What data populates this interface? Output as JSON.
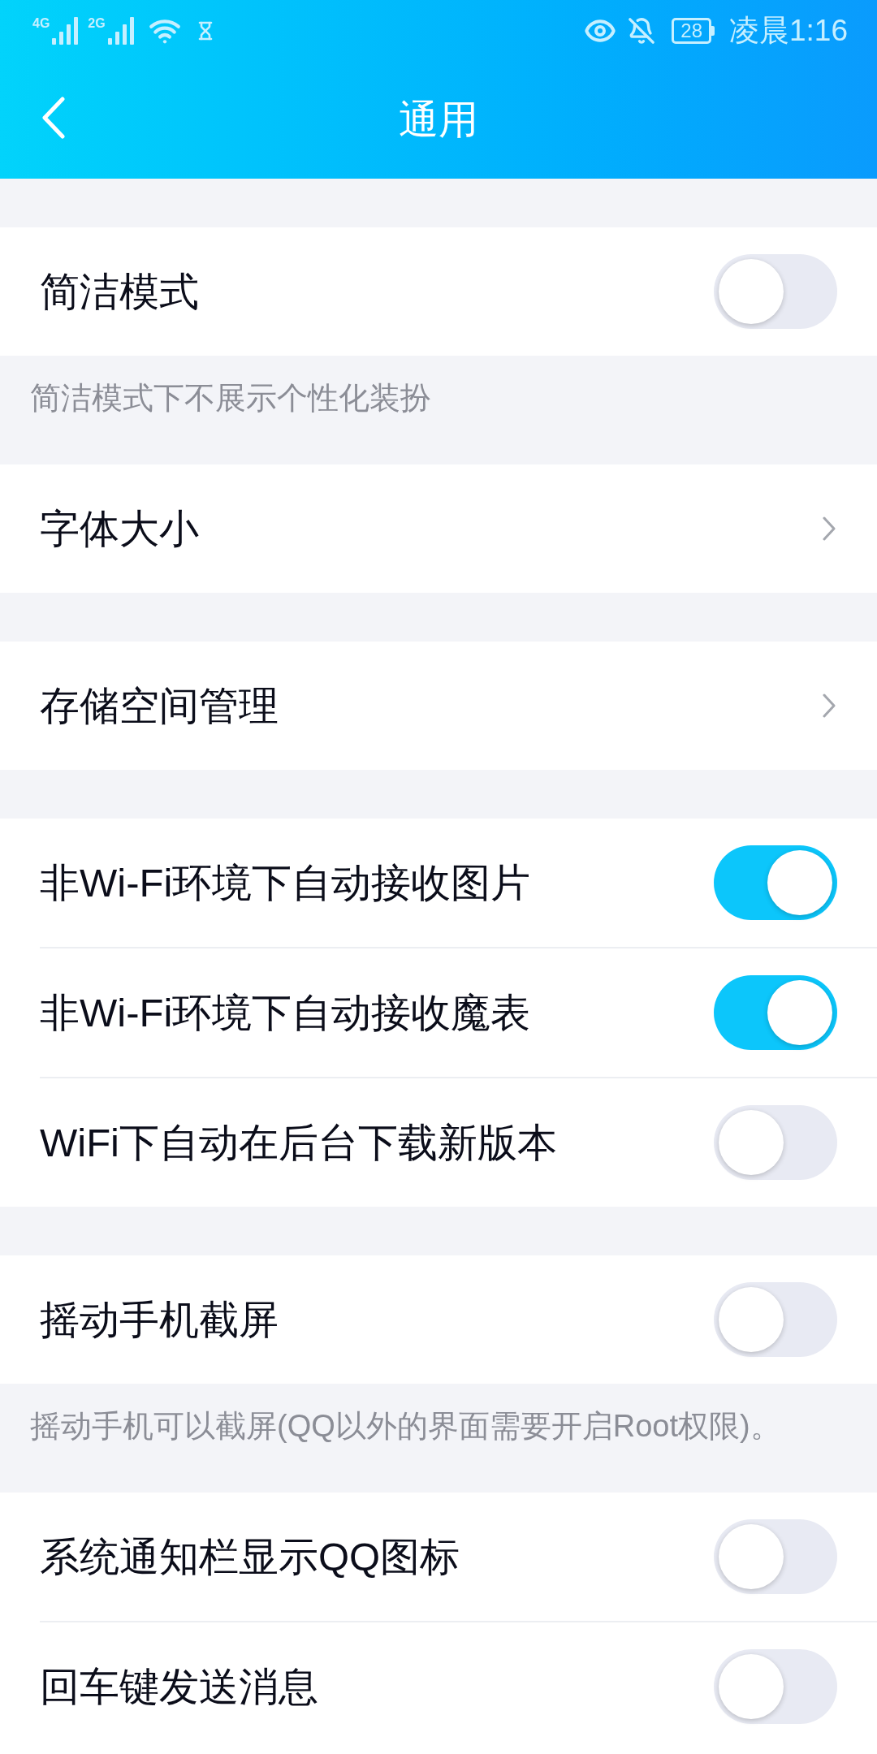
{
  "status_bar": {
    "signals": [
      {
        "label": "4G"
      },
      {
        "label": "2G"
      }
    ],
    "battery": "28",
    "time": "凌晨1:16"
  },
  "title_bar": {
    "title": "通用"
  },
  "sections": [
    {
      "items": [
        {
          "kind": "toggle",
          "label": "简洁模式",
          "on": false
        }
      ],
      "note": "简洁模式下不展示个性化装扮"
    },
    {
      "items": [
        {
          "kind": "link",
          "label": "字体大小"
        }
      ]
    },
    {
      "items": [
        {
          "kind": "link",
          "label": "存储空间管理"
        }
      ]
    },
    {
      "items": [
        {
          "kind": "toggle",
          "label": "非Wi-Fi环境下自动接收图片",
          "on": true
        },
        {
          "kind": "toggle",
          "label": "非Wi-Fi环境下自动接收魔表",
          "on": true
        },
        {
          "kind": "toggle",
          "label": "WiFi下自动在后台下载新版本",
          "on": false
        }
      ]
    },
    {
      "items": [
        {
          "kind": "toggle",
          "label": "摇动手机截屏",
          "on": false
        }
      ],
      "note": "摇动手机可以截屏(QQ以外的界面需要开启Root权限)。"
    },
    {
      "items": [
        {
          "kind": "toggle",
          "label": "系统通知栏显示QQ图标",
          "on": false
        },
        {
          "kind": "toggle",
          "label": "回车键发送消息",
          "on": false
        }
      ]
    }
  ]
}
